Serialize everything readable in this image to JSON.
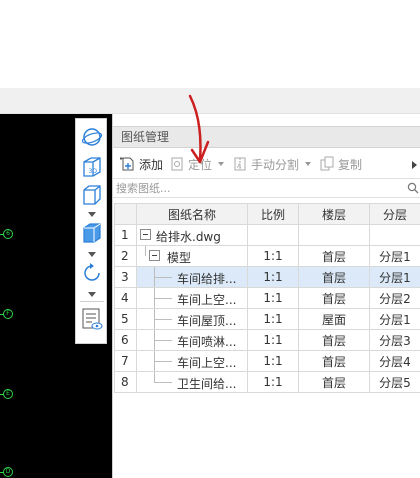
{
  "panel": {
    "title": "图纸管理",
    "toolbar": {
      "add_label": "添加",
      "locate_label": "定位",
      "manual_split_label": "手动分割",
      "copy_label": "复制"
    },
    "search": {
      "placeholder": "搜索图纸..."
    },
    "table": {
      "headers": [
        "图纸名称",
        "比例",
        "楼层",
        "分层"
      ],
      "rows": [
        {
          "num": "1",
          "name": "给排水.dwg",
          "scale": "",
          "floor": "",
          "layer": ""
        },
        {
          "num": "2",
          "name": "模型",
          "scale": "1:1",
          "floor": "首层",
          "layer": "分层1"
        },
        {
          "num": "3",
          "name": "车间给排...",
          "scale": "1:1",
          "floor": "首层",
          "layer": "分层1"
        },
        {
          "num": "4",
          "name": "车间上空...",
          "scale": "1:1",
          "floor": "首层",
          "layer": "分层2"
        },
        {
          "num": "5",
          "name": "车间屋顶...",
          "scale": "1:1",
          "floor": "屋面",
          "layer": "分层1"
        },
        {
          "num": "6",
          "name": "车间喷淋...",
          "scale": "1:1",
          "floor": "首层",
          "layer": "分层3"
        },
        {
          "num": "7",
          "name": "车间上空...",
          "scale": "1:1",
          "floor": "首层",
          "layer": "分层4"
        },
        {
          "num": "8",
          "name": "卫生间给...",
          "scale": "1:1",
          "floor": "首层",
          "layer": "分层5"
        }
      ]
    }
  },
  "canvas": {
    "axis_labels": [
      "6",
      "F",
      "E",
      "D"
    ]
  },
  "colors": {
    "canvas_bg": "#000000",
    "axis_green": "#2fd64a",
    "selected_row": "#dbe9f9",
    "icon_blue": "#2b7fd9",
    "annotation_red": "#cc1f1f"
  }
}
